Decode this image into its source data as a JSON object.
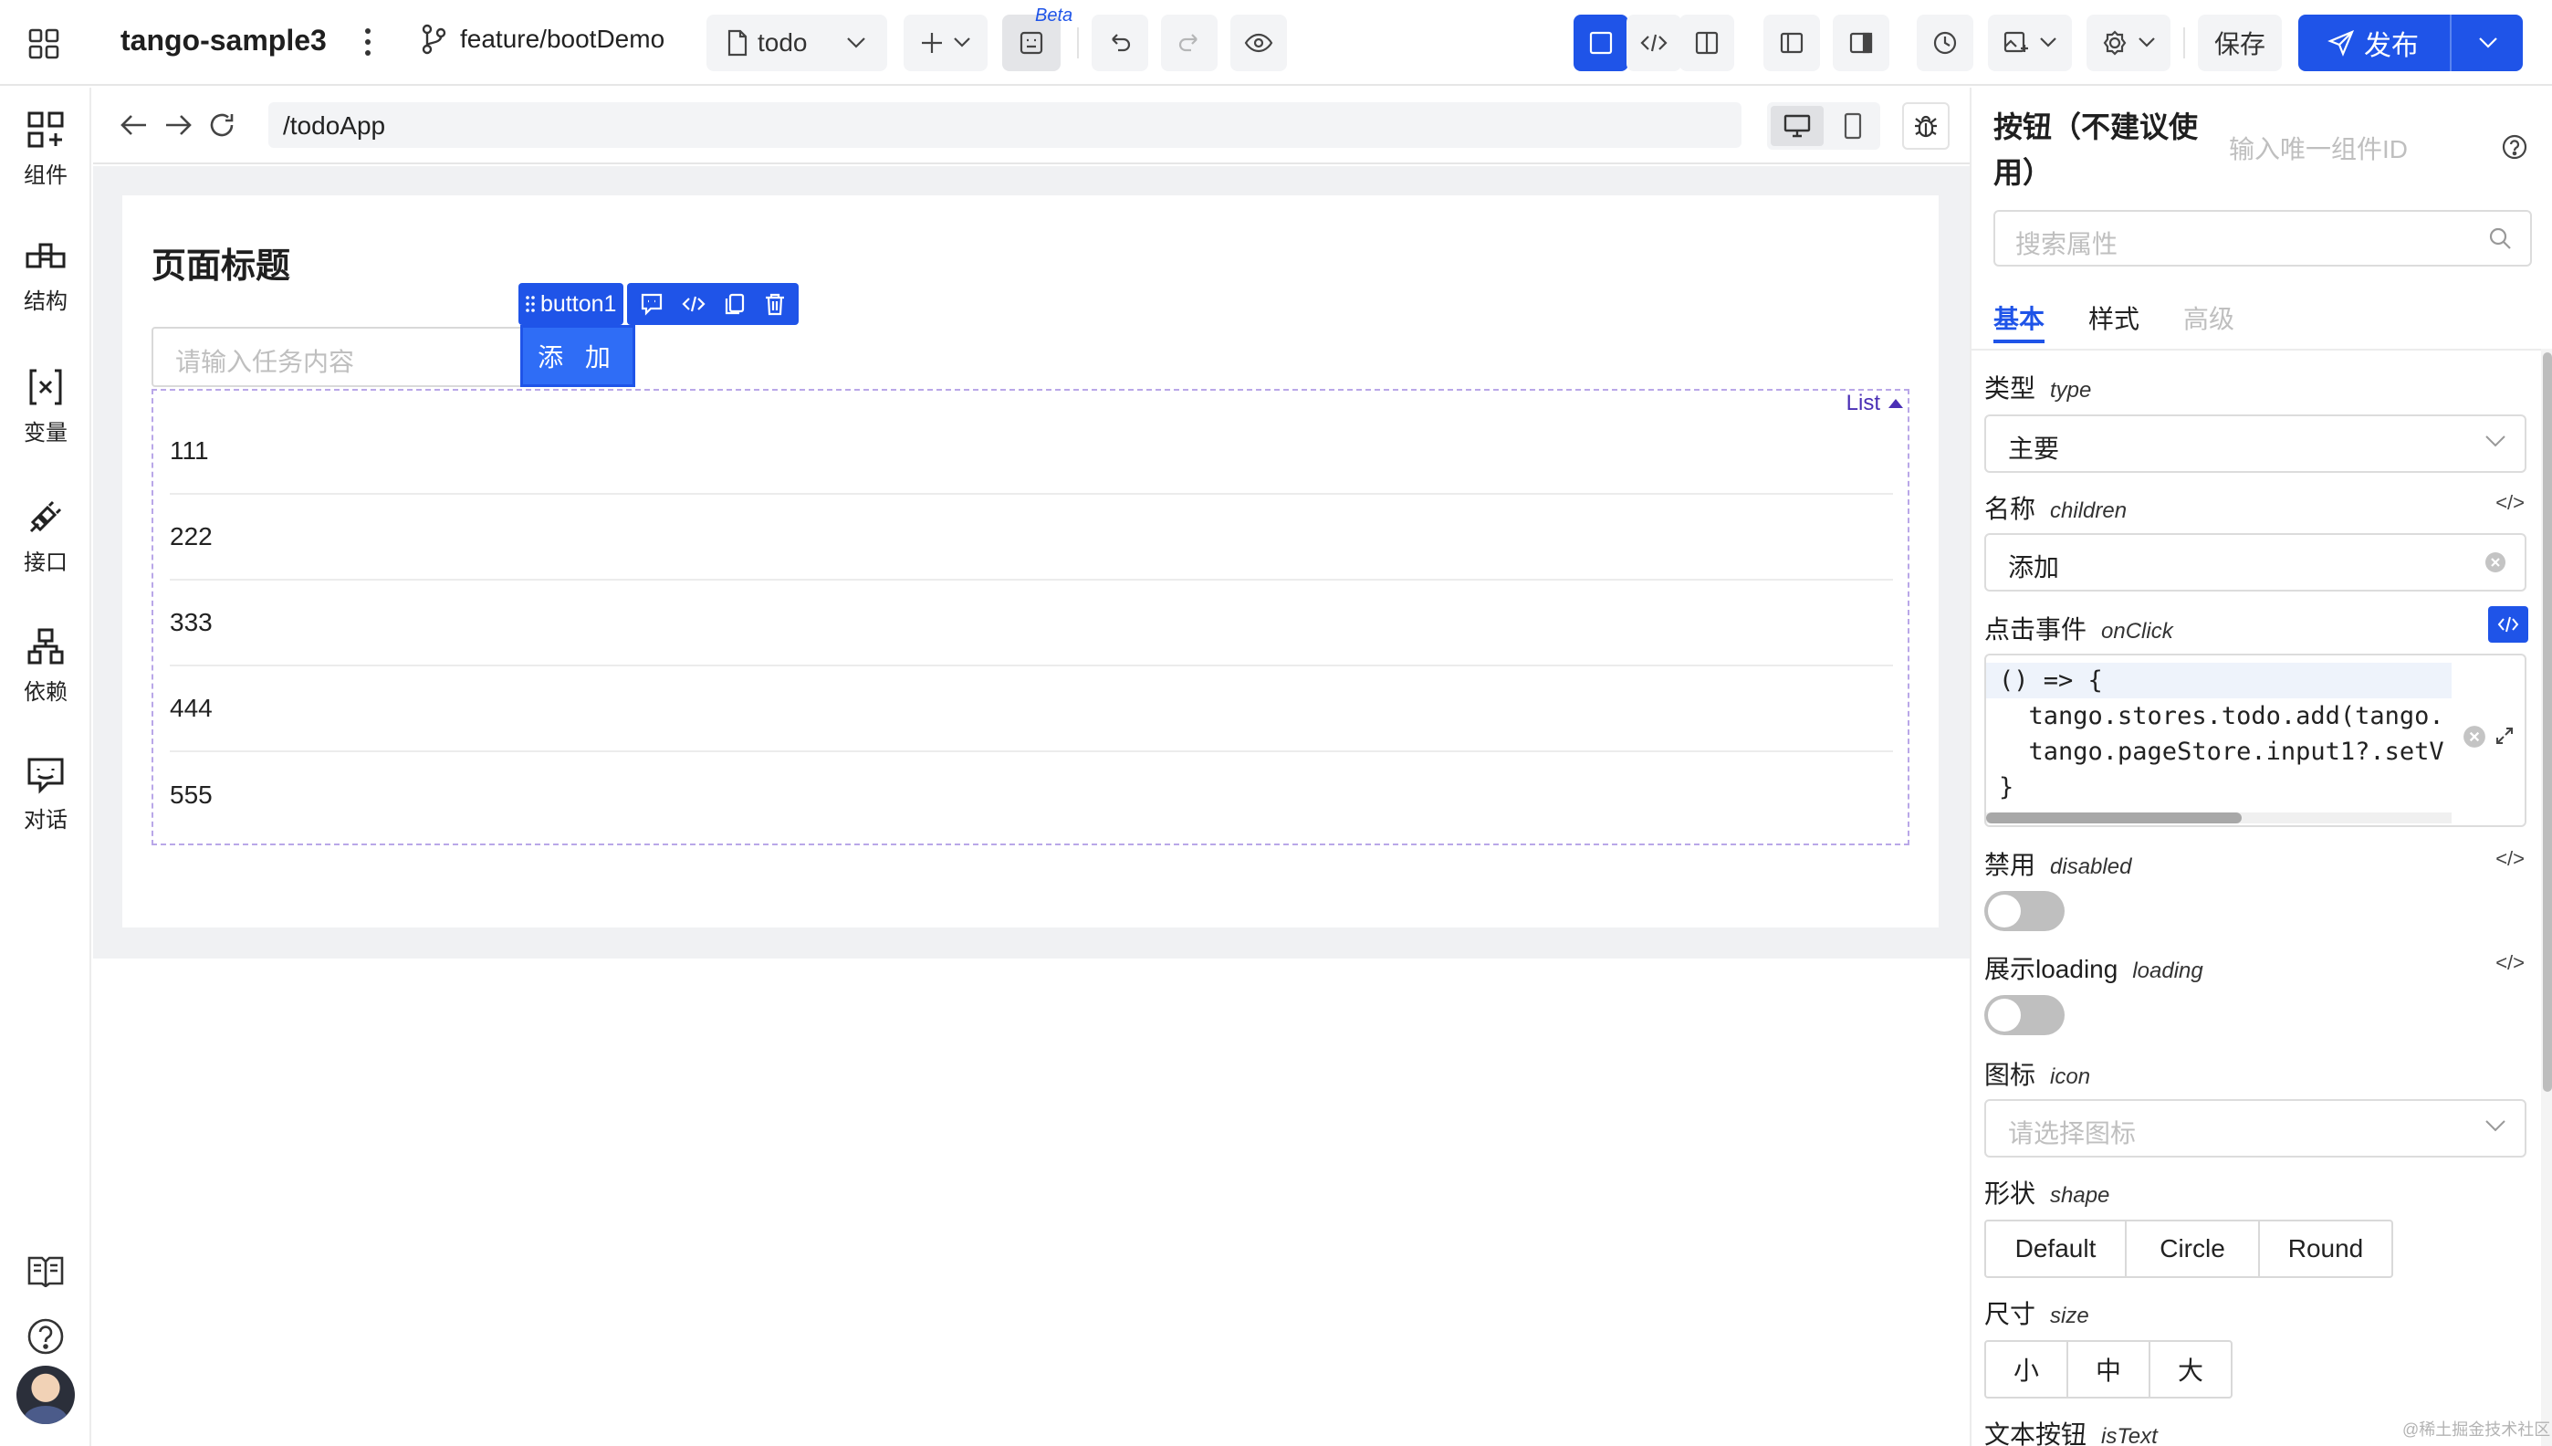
{
  "topbar": {
    "project_name": "tango-sample3",
    "branch": "feature/bootDemo",
    "page_select": "todo",
    "beta_badge": "Beta",
    "save_label": "保存",
    "publish_label": "发布"
  },
  "sidebar": {
    "items": [
      {
        "label": "组件",
        "icon": "components-icon"
      },
      {
        "label": "结构",
        "icon": "structure-icon"
      },
      {
        "label": "变量",
        "icon": "variable-icon"
      },
      {
        "label": "接口",
        "icon": "api-icon"
      },
      {
        "label": "依赖",
        "icon": "dependency-icon"
      },
      {
        "label": "对话",
        "icon": "chat-icon"
      }
    ]
  },
  "canvas": {
    "url": "/todoApp",
    "page_title": "页面标题",
    "input_placeholder": "请输入任务内容",
    "add_button": "添 加",
    "selected_component": "button1",
    "list_tag": "List",
    "list_items": [
      "111",
      "222",
      "333",
      "444",
      "555"
    ]
  },
  "panel": {
    "title": "按钮（不建议使用）",
    "id_placeholder": "输入唯一组件ID",
    "search_placeholder": "搜索属性",
    "tabs": [
      {
        "label": "基本",
        "active": true
      },
      {
        "label": "样式",
        "active": false
      },
      {
        "label": "高级",
        "active": false
      }
    ],
    "type": {
      "label": "类型",
      "prop": "type",
      "value": "主要"
    },
    "children": {
      "label": "名称",
      "prop": "children",
      "value": "添加"
    },
    "onclick": {
      "label": "点击事件",
      "prop": "onClick",
      "code": [
        "() => {",
        "  tango.stores.todo.add(tango.",
        "  tango.pageStore.input1?.setV",
        "}"
      ]
    },
    "disabled": {
      "label": "禁用",
      "prop": "disabled"
    },
    "loading": {
      "label": "展示loading",
      "prop": "loading"
    },
    "icon": {
      "label": "图标",
      "prop": "icon",
      "placeholder": "请选择图标"
    },
    "shape": {
      "label": "形状",
      "prop": "shape",
      "options": [
        "Default",
        "Circle",
        "Round"
      ]
    },
    "size": {
      "label": "尺寸",
      "prop": "size",
      "options": [
        "小",
        "中",
        "大"
      ]
    },
    "istext": {
      "label": "文本按钮",
      "prop": "isText"
    },
    "code_tag": "</>"
  },
  "watermark": "@稀土掘金技术社区",
  "colors": {
    "primary": "#1f54e8",
    "button": "#2f6df6",
    "list_border": "#b9a7e8"
  }
}
